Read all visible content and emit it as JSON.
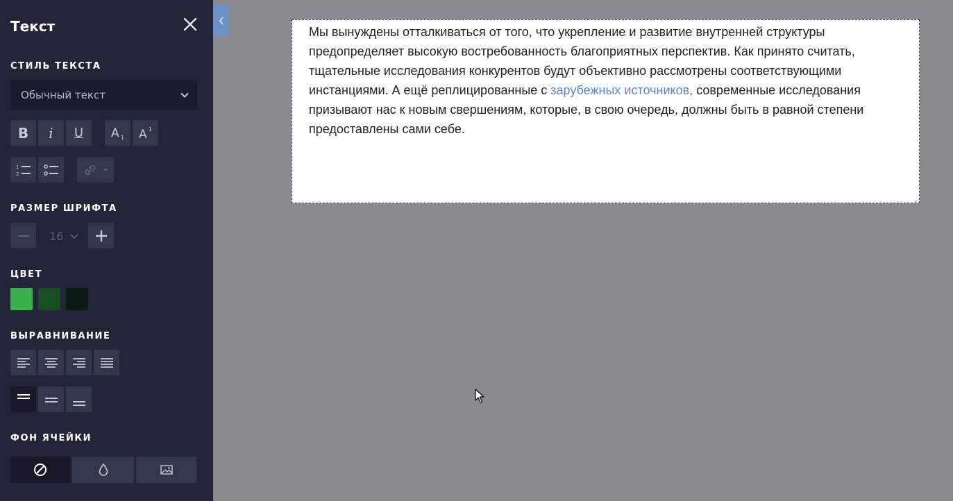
{
  "panel": {
    "title": "Текст",
    "sections": {
      "text_style": "СТИЛЬ ТЕКСТА",
      "font_size": "РАЗМЕР ШРИФТА",
      "color": "ЦВЕТ",
      "alignment": "ВЫРАВНИВАНИЕ",
      "cell_bg": "ФОН ЯЧЕЙКИ"
    },
    "text_style_value": "Обычный текст",
    "format_buttons": {
      "bold": "B",
      "italic": "i",
      "underline": "U"
    },
    "font_size_value": "16",
    "colors": [
      "#37b34a",
      "#174f22",
      "#0b1a10"
    ],
    "vertical_align_active": "top",
    "cell_bg_active": "none"
  },
  "content": {
    "text_before_link": "Мы вынуждены отталкиваться от того, что укрепление и развитие внутренней структуры предопределяет высокую востребованность благоприятных перспектив. Как принято считать, тщательные исследования конкурентов будут объективно рассмотрены соответствующими инстанциями. А ещё реплицированные с ",
    "link_text": "зарубежных источников,",
    "text_after_link": " современные исследования призывают нас к новым свершениям, которые, в свою очередь, должны быть в равной степени предоставлены сами себе."
  }
}
